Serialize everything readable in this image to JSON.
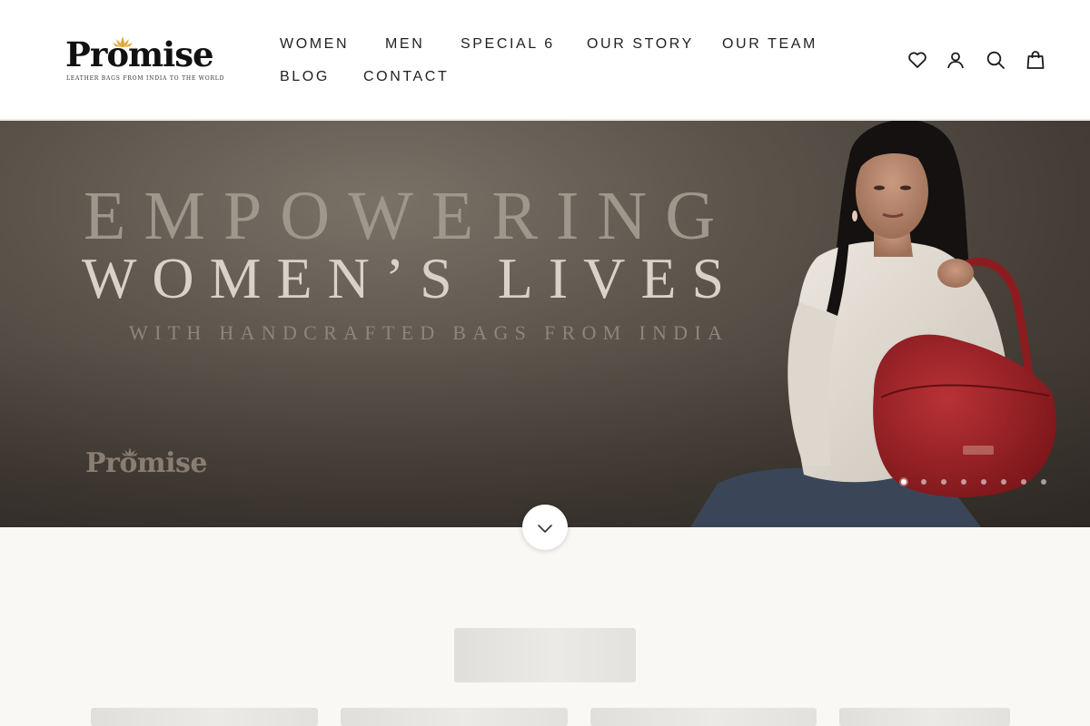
{
  "brand": {
    "name": "Promise",
    "tagline": "LEATHER BAGS FROM INDIA TO THE WORLD",
    "accent_color": "#e0a530"
  },
  "nav": {
    "items": [
      {
        "label": "WOMEN"
      },
      {
        "label": "MEN"
      },
      {
        "label": "SPECIAL 6"
      },
      {
        "label": "OUR STORY"
      },
      {
        "label": "OUR TEAM"
      },
      {
        "label": "BLOG"
      },
      {
        "label": "CONTACT"
      }
    ]
  },
  "header_icons": [
    "heart-icon",
    "account-icon",
    "search-icon",
    "bag-icon"
  ],
  "hero": {
    "title_line1": "EMPOWERING",
    "title_line2": "WOMEN’S LIVES",
    "subtitle": "WITH HANDCRAFTED BAGS FROM INDIA",
    "watermark_logo": "Promise",
    "bag_color": "#a42428",
    "slides_total": 8,
    "active_slide": 1
  },
  "scroll_icon": "chevron-down-icon"
}
